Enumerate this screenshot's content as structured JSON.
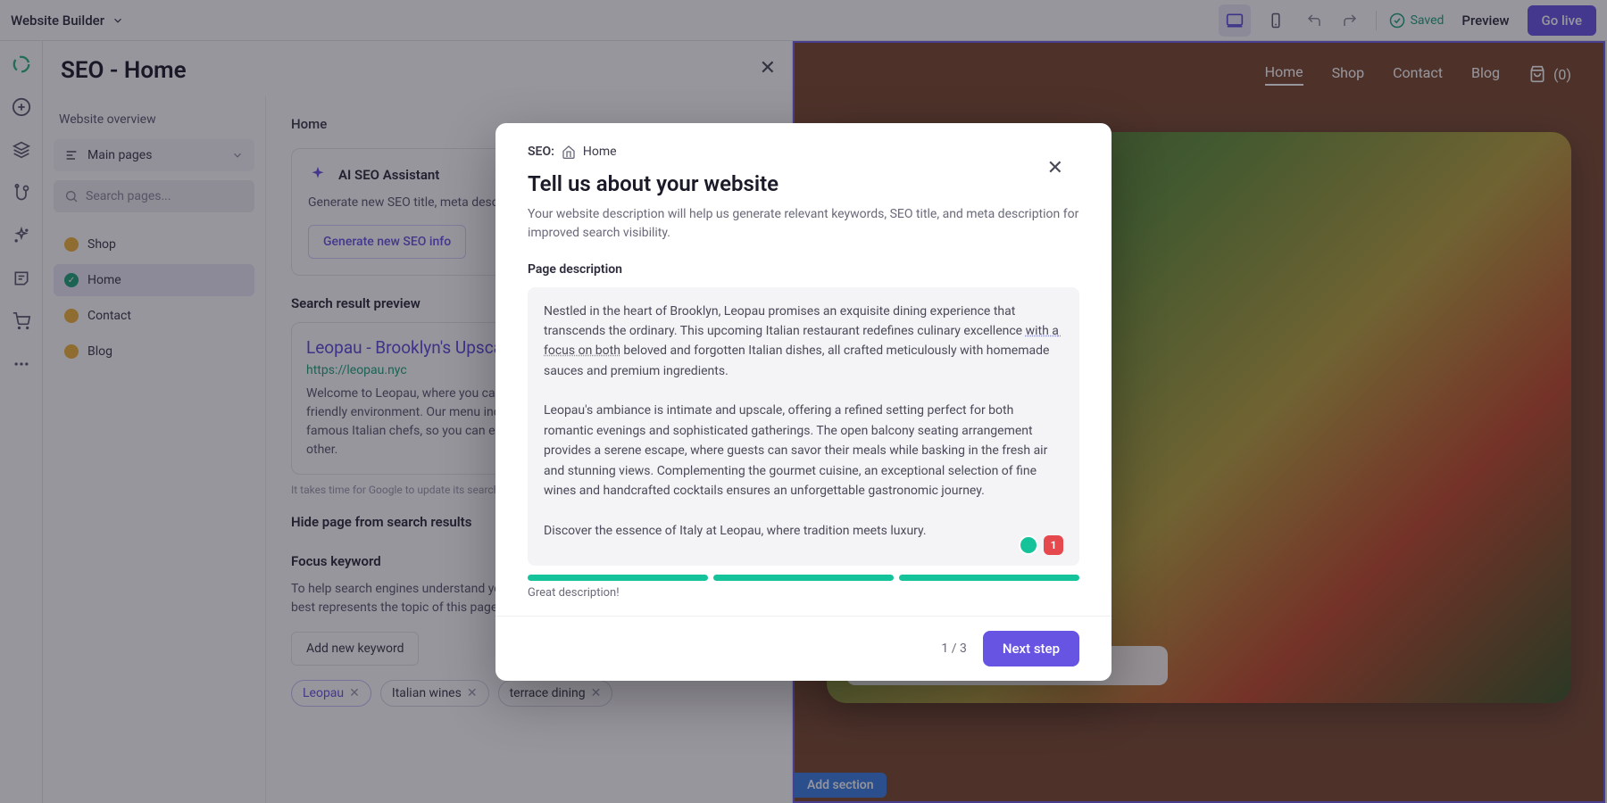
{
  "topbar": {
    "app_label": "Website Builder",
    "saved_label": "Saved",
    "preview_label": "Preview",
    "golive_label": "Go live"
  },
  "seo_panel": {
    "title": "SEO - Home",
    "website_overview": "Website overview",
    "main_pages": "Main pages",
    "search_placeholder": "Search pages...",
    "pages": [
      {
        "label": "Shop"
      },
      {
        "label": "Home"
      },
      {
        "label": "Contact"
      },
      {
        "label": "Blog"
      }
    ],
    "home_heading": "Home",
    "ai": {
      "title": "AI SEO Assistant",
      "desc": "Generate new SEO title, meta description, and keywords for this page",
      "button": "Generate new SEO info"
    },
    "srp": {
      "heading": "Search result preview",
      "title": "Leopau - Brooklyn's Upscale Italian Dining",
      "url": "https://leopau.nyc",
      "desc": "Welcome to Leopau, where you can enjoy delicious Italian food in a warm and friendly environment. Our menu includes authentic dishes and recipes from famous Italian chefs, so you can enjoy a unique culinary experience like no other.",
      "hint": "It takes time for Google to update its search results"
    },
    "hide_heading": "Hide page from search results",
    "focus_heading": "Focus keyword",
    "focus_help": "To help search engines understand your content, add a keyword or keyphrase that best represents the topic of this page",
    "add_keyword": "Add new keyword",
    "keywords": [
      "Leopau",
      "Italian wines",
      "terrace dining"
    ]
  },
  "site_nav": {
    "items": [
      "Home",
      "Shop",
      "Contact",
      "Blog"
    ],
    "cart": "(0)"
  },
  "add_section": "Add section",
  "modal": {
    "crumb_label": "SEO:",
    "crumb_page": "Home",
    "title": "Tell us about your website",
    "subtitle": "Your website description will help us generate relevant keywords, SEO title, and meta description for improved search visibility.",
    "field_label": "Page description",
    "description_p1a": "Nestled in the heart of Brooklyn, Leopau promises an exquisite dining experience that transcends the ordinary. This upcoming Italian restaurant redefines culinary excellence ",
    "description_underlined": "with a focus on both",
    "description_p1b": " beloved and forgotten Italian dishes, all crafted meticulously with homemade sauces and premium ingredients.",
    "description_p2": "Leopau's ambiance is intimate and upscale, offering a refined setting perfect for both romantic evenings and sophisticated gatherings. The open balcony seating arrangement provides a serene escape, where guests can savor their meals while basking in the fresh air and stunning views. Complementing the gourmet cuisine, an exceptional selection of fine wines and handcrafted cocktails ensures an unforgettable gastronomic journey.",
    "description_p3": "Discover the essence of Italy at Leopau, where tradition meets luxury.",
    "meter_label": "Great description!",
    "error_count": "1",
    "step": "1 / 3",
    "next": "Next step"
  }
}
